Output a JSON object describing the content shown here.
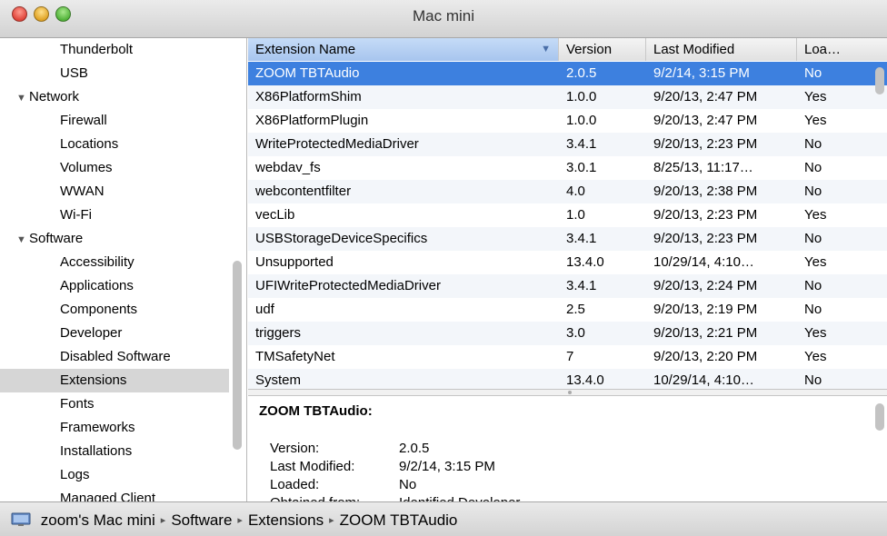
{
  "window": {
    "title": "Mac mini"
  },
  "sidebar": {
    "items": [
      {
        "label": "Thunderbolt",
        "kind": "child"
      },
      {
        "label": "USB",
        "kind": "child"
      },
      {
        "label": "Network",
        "kind": "group"
      },
      {
        "label": "Firewall",
        "kind": "child"
      },
      {
        "label": "Locations",
        "kind": "child"
      },
      {
        "label": "Volumes",
        "kind": "child"
      },
      {
        "label": "WWAN",
        "kind": "child"
      },
      {
        "label": "Wi-Fi",
        "kind": "child"
      },
      {
        "label": "Software",
        "kind": "group"
      },
      {
        "label": "Accessibility",
        "kind": "child"
      },
      {
        "label": "Applications",
        "kind": "child"
      },
      {
        "label": "Components",
        "kind": "child"
      },
      {
        "label": "Developer",
        "kind": "child"
      },
      {
        "label": "Disabled Software",
        "kind": "child"
      },
      {
        "label": "Extensions",
        "kind": "child",
        "selected": true
      },
      {
        "label": "Fonts",
        "kind": "child"
      },
      {
        "label": "Frameworks",
        "kind": "child"
      },
      {
        "label": "Installations",
        "kind": "child"
      },
      {
        "label": "Logs",
        "kind": "child"
      },
      {
        "label": "Managed Client",
        "kind": "child"
      }
    ]
  },
  "table": {
    "columns": [
      "Extension Name",
      "Version",
      "Last Modified",
      "Loa…"
    ],
    "rows": [
      [
        "ZOOM TBTAudio",
        "2.0.5",
        "9/2/14, 3:15 PM",
        "No"
      ],
      [
        "X86PlatformShim",
        "1.0.0",
        "9/20/13, 2:47 PM",
        "Yes"
      ],
      [
        "X86PlatformPlugin",
        "1.0.0",
        "9/20/13, 2:47 PM",
        "Yes"
      ],
      [
        "WriteProtectedMediaDriver",
        "3.4.1",
        "9/20/13, 2:23 PM",
        "No"
      ],
      [
        "webdav_fs",
        "3.0.1",
        "8/25/13, 11:17…",
        "No"
      ],
      [
        "webcontentfilter",
        "4.0",
        "9/20/13, 2:38 PM",
        "No"
      ],
      [
        "vecLib",
        "1.0",
        "9/20/13, 2:23 PM",
        "Yes"
      ],
      [
        "USBStorageDeviceSpecifics",
        "3.4.1",
        "9/20/13, 2:23 PM",
        "No"
      ],
      [
        "Unsupported",
        "13.4.0",
        "10/29/14, 4:10…",
        "Yes"
      ],
      [
        "UFIWriteProtectedMediaDriver",
        "3.4.1",
        "9/20/13, 2:24 PM",
        "No"
      ],
      [
        "udf",
        "2.5",
        "9/20/13, 2:19 PM",
        "No"
      ],
      [
        "triggers",
        "3.0",
        "9/20/13, 2:21 PM",
        "Yes"
      ],
      [
        "TMSafetyNet",
        "7",
        "9/20/13, 2:20 PM",
        "Yes"
      ],
      [
        "System",
        "13.4.0",
        "10/29/14, 4:10…",
        "No"
      ]
    ],
    "selected_row": 0
  },
  "detail": {
    "title": "ZOOM TBTAudio:",
    "fields": [
      {
        "key": "Version:",
        "value": "2.0.5"
      },
      {
        "key": "Last Modified:",
        "value": "9/2/14, 3:15 PM"
      },
      {
        "key": "Loaded:",
        "value": "No"
      },
      {
        "key": "Obtained from:",
        "value": "Identified Developer"
      }
    ]
  },
  "pathbar": {
    "crumbs": [
      "zoom's Mac mini",
      "Software",
      "Extensions",
      "ZOOM TBTAudio"
    ]
  },
  "colors": {
    "selection": "#3d80df",
    "sidebar_selection": "#d6d6d6"
  }
}
